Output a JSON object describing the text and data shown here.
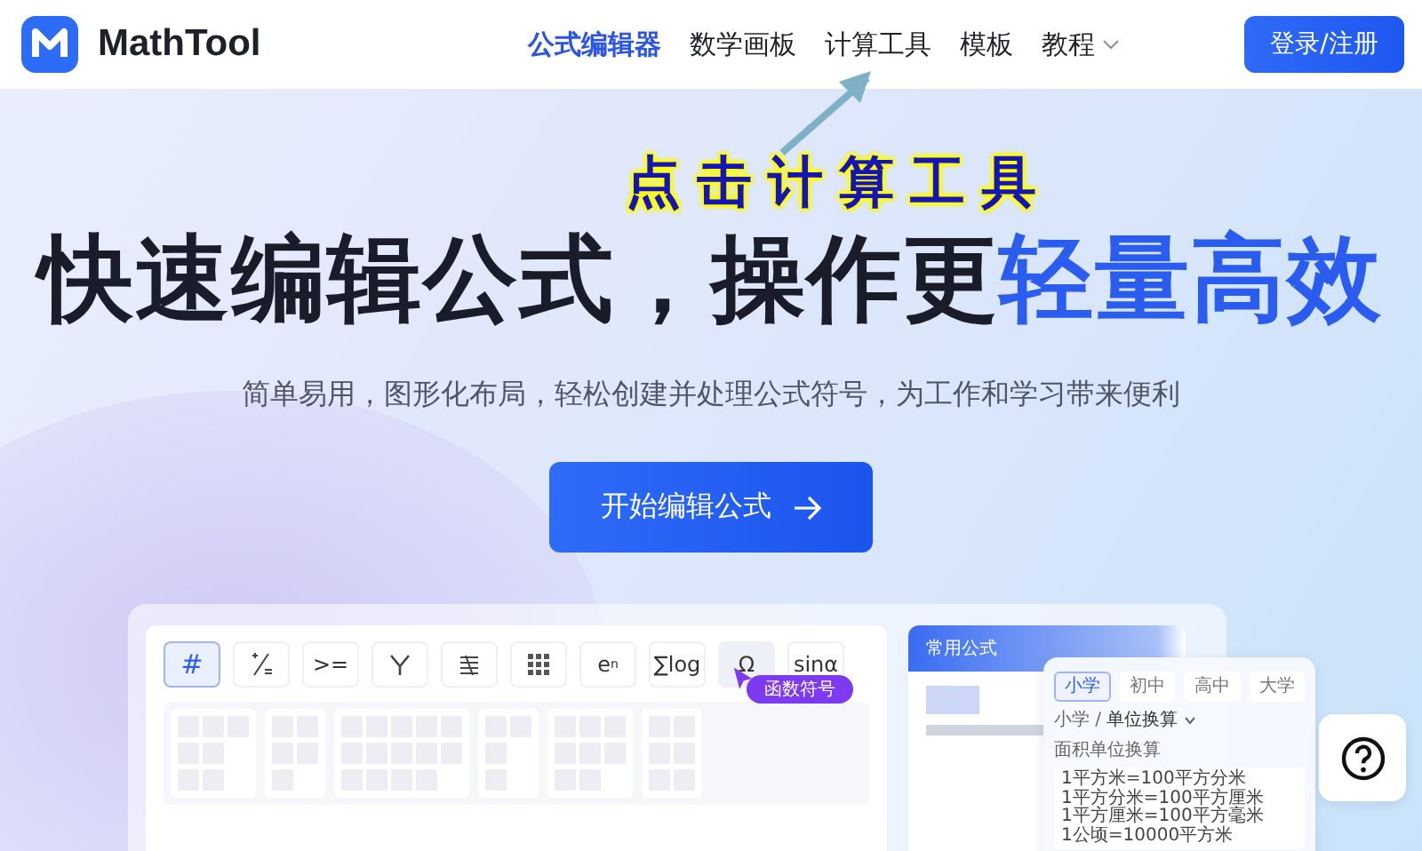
{
  "header": {
    "brand": "MathTool",
    "nav": [
      {
        "label": "公式编辑器",
        "selected": true,
        "has_menu": false
      },
      {
        "label": "数学画板",
        "selected": false,
        "has_menu": false
      },
      {
        "label": "计算工具",
        "selected": false,
        "has_menu": false
      },
      {
        "label": "模板",
        "selected": false,
        "has_menu": false
      },
      {
        "label": "教程",
        "selected": false,
        "has_menu": true
      }
    ],
    "login": "登录/注册"
  },
  "annotation": "点击计算工具",
  "hero": {
    "headline": "快速编辑公式，操作更",
    "headline_highlight": "轻量高效",
    "subtitle": "简单易用，图形化布局，轻松创建并处理公式符号，为工作和学习带来便利",
    "cta": "开始编辑公式"
  },
  "preview": {
    "tools": [
      {
        "kind": "text",
        "label": "#",
        "selected": true,
        "hovered": false
      },
      {
        "kind": "fraction",
        "selected": false,
        "hovered": false
      },
      {
        "kind": "text",
        "label": ">=",
        "selected": false,
        "hovered": false
      },
      {
        "kind": "branch",
        "selected": false,
        "hovered": false
      },
      {
        "kind": "stack",
        "selected": false,
        "hovered": false
      },
      {
        "kind": "grid",
        "selected": false,
        "hovered": false
      },
      {
        "kind": "text",
        "label": "e$^{n}$",
        "selected": false,
        "hovered": false
      },
      {
        "kind": "text",
        "label": "∑log",
        "selected": false,
        "hovered": false
      },
      {
        "kind": "text",
        "label": "Ω",
        "selected": false,
        "hovered": true
      },
      {
        "kind": "text",
        "label": "sinα",
        "selected": false,
        "hovered": false
      }
    ],
    "tooltip": "函数符号",
    "formulas_title": "常用公式",
    "levels": [
      {
        "label": "小学",
        "selected": true
      },
      {
        "label": "初中",
        "selected": false
      },
      {
        "label": "高中",
        "selected": false
      },
      {
        "label": "大学",
        "selected": false
      }
    ],
    "breadcrumb": {
      "root": "小学 /",
      "current": "单位换算"
    },
    "section": "面积单位换算",
    "formulas": [
      "1平方米=100平方分米",
      "1平方分米=100平方厘米",
      "1平方厘米=100平方毫米",
      "1公顷=10000平方米"
    ]
  }
}
